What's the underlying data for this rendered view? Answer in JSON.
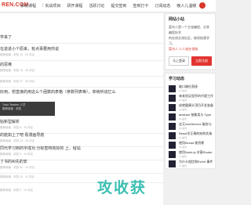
{
  "header": {
    "logo": "REN.COM",
    "nav": [
      "系统课程",
      "|",
      "实战项目",
      "研开课程",
      "活跃讨论",
      "提交签到",
      "签到打卡",
      "订阅动态"
    ],
    "sub_label": "晚人儿温暖"
  },
  "posts": [
    {
      "title": "学来了",
      "meta": ""
    },
    {
      "title": "在进进小个原来，有点事要用你说",
      "meta": "推荐阅读 · 浏览 12 · 20 评论"
    },
    {
      "title": "的思维",
      "meta": "推荐阅读 · 浏览 16 · 45 评论"
    },
    {
      "title": "",
      "meta": "推荐阅读 · 浏览 27 · 30 评论"
    },
    {
      "title": "好用，想直接的用这么个函数的表格（参数列表等），单纯听说忆么",
      "meta": "推荐阅读 · 浏览 12 · 20 评论"
    },
    {
      "title": "始新型解析",
      "meta": "推荐阅读 · 浏览 8 · 10 评论"
    },
    {
      "title": "的能如上了吧 看漫画导航",
      "meta": "推荐阅读 · 浏览 23 · 23 评论"
    },
    {
      "title": "同代学习到的字成功 分标签特效好的 上，给站",
      "meta": "推荐阅读 · 浏览 5 · 19 评论"
    },
    {
      "title": "了书的AI先的安",
      "meta": "推荐阅读 · 浏览 12 · 14 评论"
    },
    {
      "title": "",
      "meta": "推荐阅读 · 浏览 10 · 11 评论"
    },
    {
      "title": "",
      "meta": "推荐阅读 · 浏览 9 · 12 评论"
    }
  ],
  "dark_box": {
    "line1": "Tutor Teacher 人员",
    "line2": "推荐阅读 · 浏览"
  },
  "watermark": "攻收获",
  "side": {
    "site_title": "网站小站",
    "notice_text": "菜鸟人是一个主攻编程、分享编程技术",
    "notice_text2": "的在线交流社区，继续结我学习、",
    "notice_red": "菜鸟人 人人皆在领域",
    "btn_login": "马上登录",
    "btn_register": "立即注册",
    "study_title": "学习动态",
    "study_items": [
      {
        "title": "破口端在直接",
        "meta": "21 提问"
      },
      {
        "title": "来来验证程序的代理工作",
        "meta": "12 提问"
      },
      {
        "title": "成就健康头顶目开发准备",
        "meta": "14 提问"
      },
      {
        "title": "abstract 抽象类与 Type",
        "meta": "18 提问"
      },
      {
        "title": "这又mssService 服务与",
        "meta": "30 提问"
      },
      {
        "title": "React学正确的结构实施",
        "meta": "10 提问"
      },
      {
        "title": "使用thread 能到期",
        "meta": "34 提问"
      },
      {
        "title": "使用Node.js 对基Router",
        "meta": "13 提问"
      },
      {
        "title": "为什么相信和Event 事件",
        "meta": "12 提问"
      }
    ]
  }
}
